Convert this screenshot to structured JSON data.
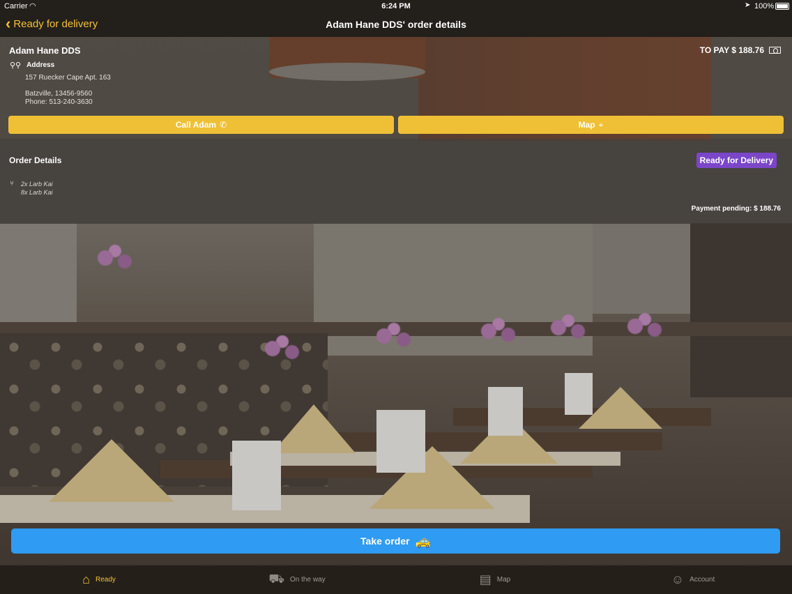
{
  "status_bar": {
    "carrier": "Carrier",
    "time": "6:24 PM",
    "battery": "100%"
  },
  "nav": {
    "back_label": "Ready for delivery",
    "title": "Adam Hane DDS' order details"
  },
  "customer": {
    "name": "Adam Hane DDS",
    "to_pay": "TO PAY $ 188.76",
    "address_label": "Address",
    "address_line1": "157 Ruecker Cape Apt. 163",
    "address_line2": "Batzville, 13456-9560",
    "phone": "Phone: 513-240-3630",
    "call_label": "Call Adam",
    "map_label": "Map"
  },
  "order": {
    "title": "Order Details",
    "status": "Ready for Delivery",
    "items": [
      "2x Larb Kai",
      "8x Larb Kai"
    ],
    "payment_pending": "Payment pending: $ 188.76"
  },
  "take_order_label": "Take order",
  "tabs": [
    {
      "label": "Ready",
      "icon": "store-icon",
      "active": true
    },
    {
      "label": "On the way",
      "icon": "car-icon",
      "active": false
    },
    {
      "label": "Map",
      "icon": "map-icon",
      "active": false
    },
    {
      "label": "Account",
      "icon": "person-icon",
      "active": false
    }
  ],
  "colors": {
    "accent": "#efc036",
    "primary_button": "#2f9bf2",
    "status_badge": "#7b46c9",
    "bar_background": "#231f1b"
  }
}
